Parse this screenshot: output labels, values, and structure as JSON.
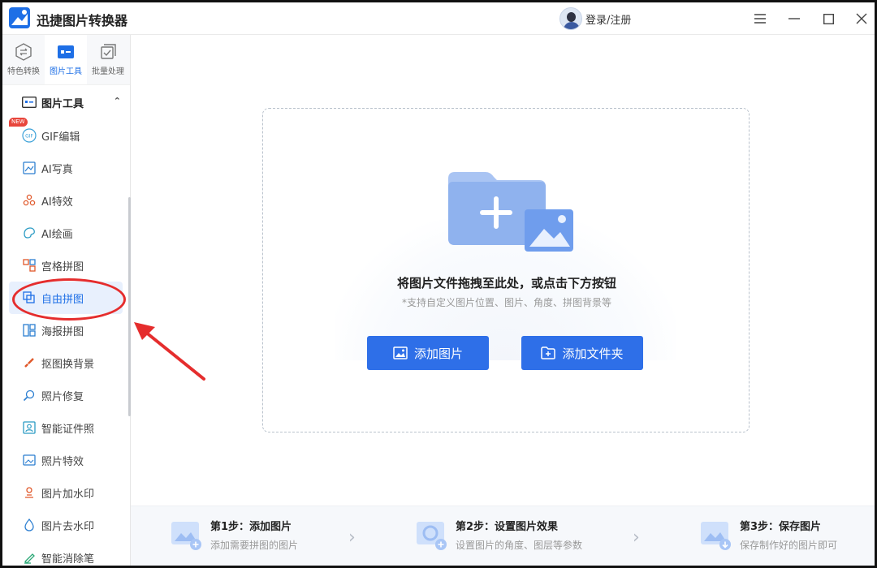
{
  "app": {
    "title": "迅捷图片转换器"
  },
  "header": {
    "login_label": "登录/注册"
  },
  "sidebar": {
    "tabs": [
      {
        "label": "特色转换",
        "icon": "convert-icon"
      },
      {
        "label": "图片工具",
        "icon": "image-tools-icon",
        "active": true
      },
      {
        "label": "批量处理",
        "icon": "batch-icon"
      }
    ],
    "group_title": "图片工具",
    "items": [
      {
        "label": "GIF编辑",
        "icon": "gif-icon",
        "badge": "NEW"
      },
      {
        "label": "AI写真",
        "icon": "ai-portrait-icon"
      },
      {
        "label": "AI特效",
        "icon": "ai-effects-icon"
      },
      {
        "label": "AI绘画",
        "icon": "ai-paint-icon"
      },
      {
        "label": "宫格拼图",
        "icon": "grid-collage-icon"
      },
      {
        "label": "自由拼图",
        "icon": "free-collage-icon",
        "active": true
      },
      {
        "label": "海报拼图",
        "icon": "poster-collage-icon"
      },
      {
        "label": "抠图换背景",
        "icon": "cutout-icon"
      },
      {
        "label": "照片修复",
        "icon": "photo-repair-icon"
      },
      {
        "label": "智能证件照",
        "icon": "id-photo-icon"
      },
      {
        "label": "照片特效",
        "icon": "photo-effects-icon"
      },
      {
        "label": "图片加水印",
        "icon": "add-watermark-icon"
      },
      {
        "label": "图片去水印",
        "icon": "remove-watermark-icon"
      },
      {
        "label": "智能消除笔",
        "icon": "eraser-pen-icon"
      }
    ]
  },
  "dropzone": {
    "title": "将图片文件拖拽至此处，或点击下方按钮",
    "subtitle": "*支持自定义图片位置、图片、角度、拼图背景等",
    "add_image_label": "添加图片",
    "add_folder_label": "添加文件夹"
  },
  "steps": [
    {
      "title": "第1步：添加图片",
      "desc": "添加需要拼图的图片"
    },
    {
      "title": "第2步：设置图片效果",
      "desc": "设置图片的角度、图层等参数"
    },
    {
      "title": "第3步：保存图片",
      "desc": "保存制作好的图片即可"
    }
  ],
  "colors": {
    "accent": "#2e6fe8",
    "annotation": "#e52d2d"
  }
}
